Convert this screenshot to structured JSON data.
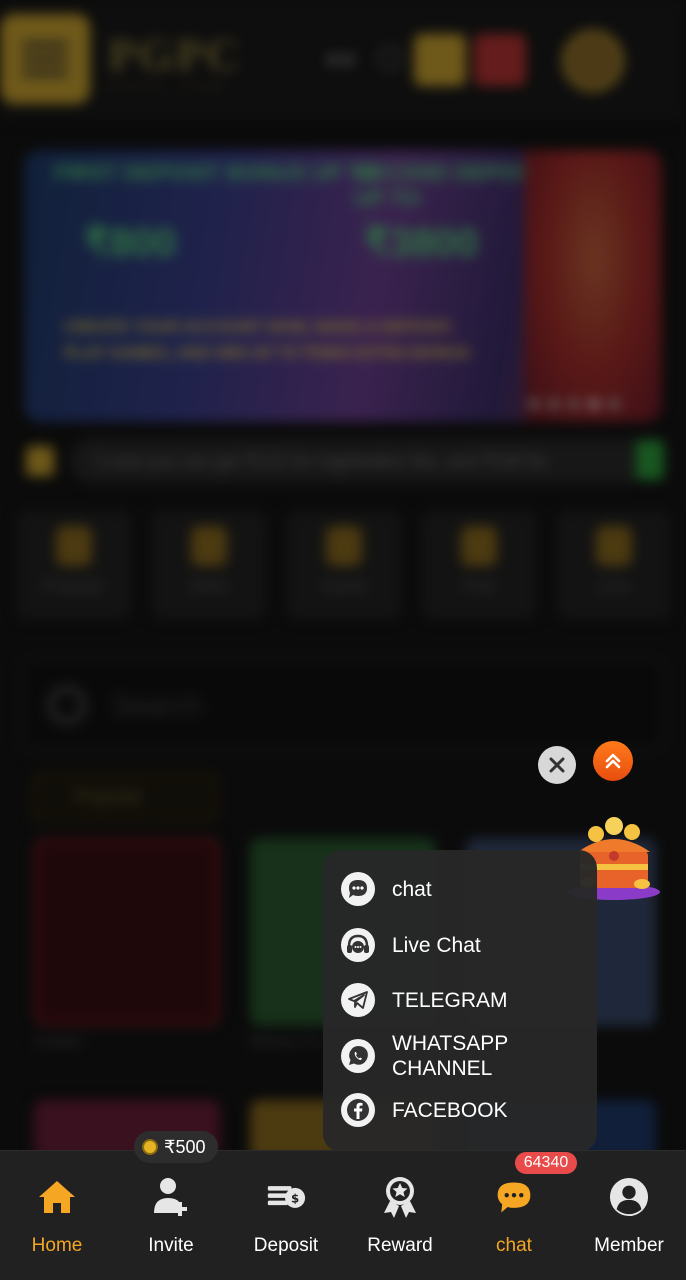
{
  "header": {
    "logo": "PGPC",
    "logo_sub": "PGPC.COM"
  },
  "banner": {
    "left_title": "FIRST DEPOSIT BONUS UP TO",
    "right_title": "SECOND DEPOSIT BONUS UP TO",
    "left_amount": "₹800",
    "right_amount": "₹3800",
    "body": "CREATE YOUR ACCOUNT NOW, MAKE A DEPOSIT, PLAY GAMES, AND WIN UP TO ₹3800 EXTRA BONUS"
  },
  "notice": {
    "text": "1.now you can get ₹121 for registration fee, and ₹100 for"
  },
  "categories": [
    {
      "label": "Popular"
    },
    {
      "label": "Slots"
    },
    {
      "label": "Cards"
    },
    {
      "label": "Fish"
    },
    {
      "label": "Live"
    }
  ],
  "search": {
    "placeholder": "Search"
  },
  "popular_tab": "Popular",
  "games": [
    {
      "name": "Aviator"
    },
    {
      "name": "Money Co"
    },
    {
      "name": ""
    }
  ],
  "popup": {
    "items": [
      {
        "icon": "chat-bubble-icon",
        "label": "chat"
      },
      {
        "icon": "headset-icon",
        "label": "Live Chat"
      },
      {
        "icon": "telegram-icon",
        "label": "TELEGRAM"
      },
      {
        "icon": "whatsapp-icon",
        "label": "WHATSAPP CHANNEL",
        "line1": "WHATSAPP",
        "line2": "CHANNEL"
      },
      {
        "icon": "facebook-icon",
        "label": "FACEBOOK"
      }
    ]
  },
  "bottom_nav": {
    "reward_badge": "₹500",
    "chat_count": "64340",
    "items": [
      {
        "label": "Home",
        "icon": "home-icon",
        "active": true
      },
      {
        "label": "Invite",
        "icon": "add-user-icon",
        "active": false
      },
      {
        "label": "Deposit",
        "icon": "deposit-icon",
        "active": false
      },
      {
        "label": "Reward",
        "icon": "reward-medal-icon",
        "active": false
      },
      {
        "label": "chat",
        "icon": "chat-icon",
        "active": true
      },
      {
        "label": "Member",
        "icon": "member-icon",
        "active": false
      }
    ]
  },
  "colors": {
    "accent": "#f5a623",
    "badge_red": "#e94b4b",
    "nav_bg": "#212121",
    "popup_bg": "#282828"
  }
}
